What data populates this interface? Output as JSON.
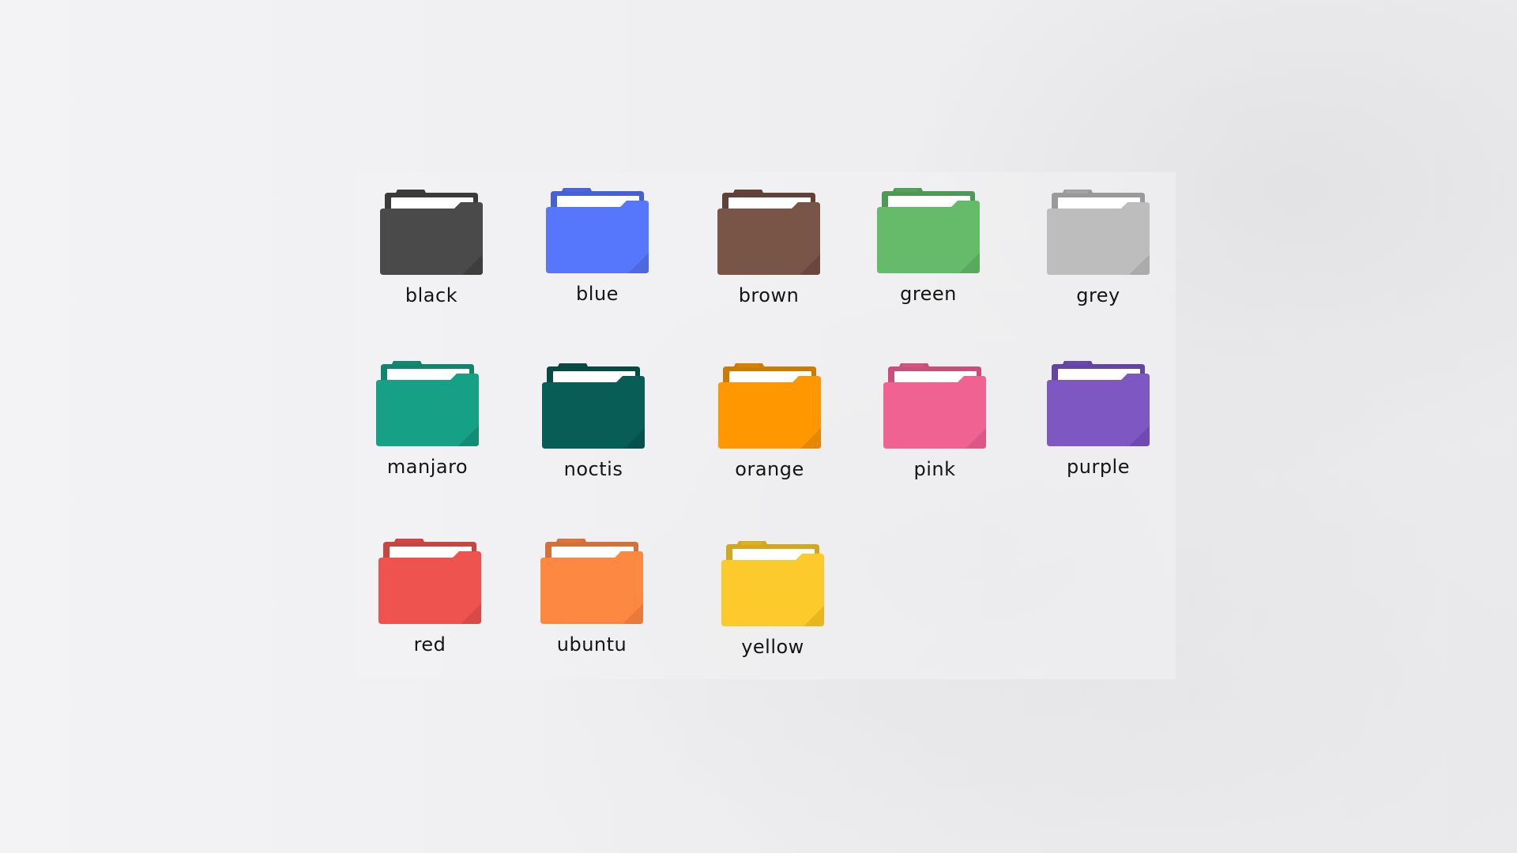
{
  "folders": [
    {
      "label": "black",
      "icon": "folder-icon",
      "colors": {
        "tab": "#3a3a3a",
        "body": "#4a4a4a",
        "fold": "#3c3c3c"
      }
    },
    {
      "label": "blue",
      "icon": "folder-icon",
      "colors": {
        "tab": "#4462d6",
        "body": "#5677fc",
        "fold": "#4a66dc"
      }
    },
    {
      "label": "brown",
      "icon": "folder-icon",
      "colors": {
        "tab": "#5f4137",
        "body": "#795548",
        "fold": "#664639"
      }
    },
    {
      "label": "green",
      "icon": "folder-icon",
      "colors": {
        "tab": "#4e9a55",
        "body": "#66bb6a",
        "fold": "#57a75c"
      }
    },
    {
      "label": "grey",
      "icon": "folder-icon",
      "colors": {
        "tab": "#9a9a9a",
        "body": "#bdbdbd",
        "fold": "#a8a8a8"
      }
    },
    {
      "label": "manjaro",
      "icon": "folder-icon",
      "colors": {
        "tab": "#12846d",
        "body": "#16a085",
        "fold": "#128a72"
      }
    },
    {
      "label": "noctis",
      "icon": "folder-icon",
      "colors": {
        "tab": "#064a43",
        "body": "#085e57",
        "fold": "#064f49"
      }
    },
    {
      "label": "orange",
      "icon": "folder-icon",
      "colors": {
        "tab": "#cc7a00",
        "body": "#ff9800",
        "fold": "#e08500"
      }
    },
    {
      "label": "pink",
      "icon": "folder-icon",
      "colors": {
        "tab": "#c94f7a",
        "body": "#f06292",
        "fold": "#d85683"
      }
    },
    {
      "label": "purple",
      "icon": "folder-icon",
      "colors": {
        "tab": "#6443a6",
        "body": "#7e57c2",
        "fold": "#6c49ae"
      }
    },
    {
      "label": "red",
      "icon": "folder-icon",
      "colors": {
        "tab": "#c94640",
        "body": "#ef5350",
        "fold": "#d54845"
      }
    },
    {
      "label": "ubuntu",
      "icon": "folder-icon",
      "colors": {
        "tab": "#d4713a",
        "body": "#fd8842",
        "fold": "#e4783a"
      }
    },
    {
      "label": "yellow",
      "icon": "folder-icon",
      "colors": {
        "tab": "#d4a81c",
        "body": "#fdca2c",
        "fold": "#e4b41f"
      }
    }
  ]
}
